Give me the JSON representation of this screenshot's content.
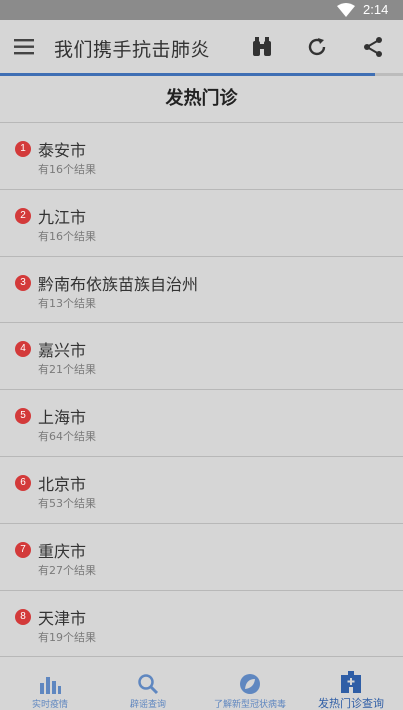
{
  "status_bar": {
    "time": "2:14"
  },
  "app_bar": {
    "title": "我们携手抗击肺炎",
    "icons": [
      "menu-icon",
      "binoculars-icon",
      "refresh-icon",
      "share-icon"
    ]
  },
  "progress": {
    "value": 0.93,
    "color": "#3f6fb4"
  },
  "section": {
    "title": "发热门诊"
  },
  "items": [
    {
      "rank": "1",
      "name": "泰安市",
      "count": "有16个结果"
    },
    {
      "rank": "2",
      "name": "九江市",
      "count": "有16个结果"
    },
    {
      "rank": "3",
      "name": "黔南布依族苗族自治州",
      "count": "有13个结果"
    },
    {
      "rank": "4",
      "name": "嘉兴市",
      "count": "有21个结果"
    },
    {
      "rank": "5",
      "name": "上海市",
      "count": "有64个结果"
    },
    {
      "rank": "6",
      "name": "北京市",
      "count": "有53个结果"
    },
    {
      "rank": "7",
      "name": "重庆市",
      "count": "有27个结果"
    },
    {
      "rank": "8",
      "name": "天津市",
      "count": "有19个结果"
    }
  ],
  "bottom_nav": [
    {
      "label": "实时疫情",
      "icon": "bar-chart-icon"
    },
    {
      "label": "辟谣查询",
      "icon": "search-icon"
    },
    {
      "label": "了解新型冠状病毒",
      "icon": "leaf-icon"
    },
    {
      "label": "发热门诊查询",
      "icon": "hospital-icon",
      "active": true
    }
  ],
  "colors": {
    "badge": "#d33a3a",
    "accent": "#3f6fb4",
    "nav": "#5f87c0"
  }
}
